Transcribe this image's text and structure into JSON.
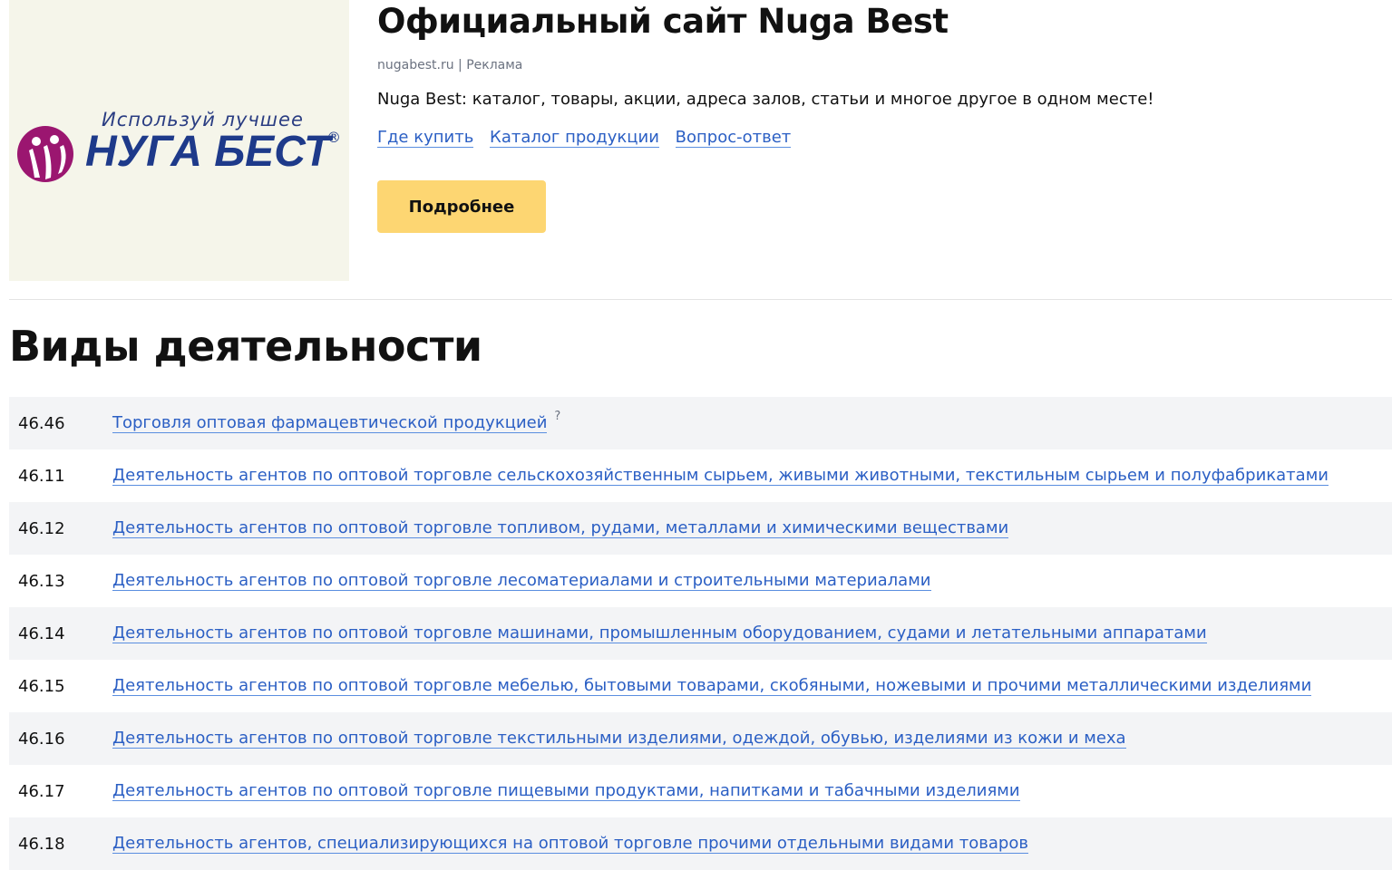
{
  "ad": {
    "logo": {
      "slogan": "Используй лучшее",
      "brand": "НУГА БЕСТ",
      "reg": "®"
    },
    "title": "Официальный сайт Nuga Best",
    "meta": "nugabest.ru | Реклама",
    "description": "Nuga Best: каталог, товары, акции, адреса залов, статьи и многое другое в одном месте!",
    "links": [
      "Где купить",
      "Каталог продукции",
      "Вопрос-ответ"
    ],
    "button": "Подробнее"
  },
  "section": {
    "title": "Виды деятельности",
    "help": "?",
    "items": [
      {
        "code": "46.46",
        "label": "Торговля оптовая фармацевтической продукцией"
      },
      {
        "code": "46.11",
        "label": "Деятельность агентов по оптовой торговле сельскохозяйственным сырьем, живыми животными, текстильным сырьем и полуфабрикатами"
      },
      {
        "code": "46.12",
        "label": "Деятельность агентов по оптовой торговле топливом, рудами, металлами и химическими веществами"
      },
      {
        "code": "46.13",
        "label": "Деятельность агентов по оптовой торговле лесоматериалами и строительными материалами"
      },
      {
        "code": "46.14",
        "label": "Деятельность агентов по оптовой торговле машинами, промышленным оборудованием, судами и летательными аппаратами"
      },
      {
        "code": "46.15",
        "label": "Деятельность агентов по оптовой торговле мебелью, бытовыми товарами, скобяными, ножевыми и прочими металлическими изделиями"
      },
      {
        "code": "46.16",
        "label": "Деятельность агентов по оптовой торговле текстильными изделиями, одеждой, обувью, изделиями из кожи и меха"
      },
      {
        "code": "46.17",
        "label": "Деятельность агентов по оптовой торговле пищевыми продуктами, напитками и табачными изделиями"
      },
      {
        "code": "46.18",
        "label": "Деятельность агентов, специализирующихся на оптовой торговле прочими отдельными видами товаров"
      }
    ]
  }
}
